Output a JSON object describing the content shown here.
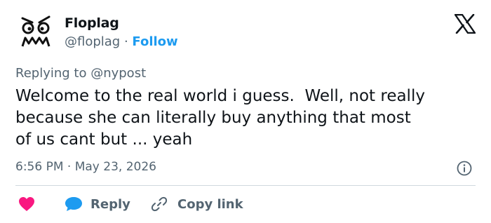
{
  "author": {
    "display_name": "Floplag",
    "handle": "@floplag",
    "separator": " · ",
    "follow_label": "Follow",
    "avatar_icon": "angry-face-doodle-icon"
  },
  "platform_icon": "x-logo-icon",
  "reply_context": "Replying to @nypost",
  "tweet": {
    "text": "Welcome to the real world i guess.  Well, not really\nbecause she can literally buy anything that most\nof us cant but ... yeah",
    "timestamp": "6:56 PM · May 23, 2026"
  },
  "actions": {
    "like_icon": "heart-icon",
    "reply_label": "Reply",
    "reply_icon": "speech-bubble-icon",
    "copy_label": "Copy link",
    "copy_icon": "link-icon"
  },
  "colors": {
    "accent": "#1d9bf0",
    "like": "#f91880",
    "muted": "#536471",
    "text": "#0f1419",
    "divider": "#cfd9de"
  }
}
